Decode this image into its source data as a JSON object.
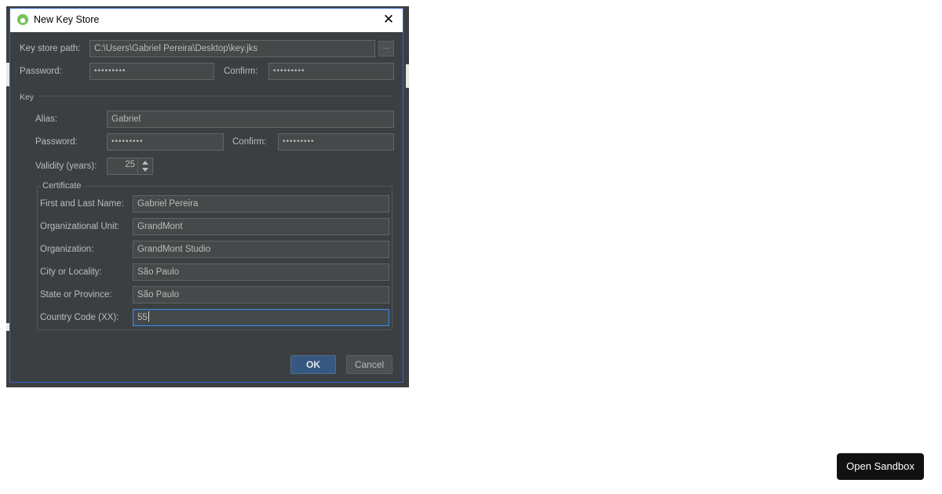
{
  "dialog": {
    "title": "New Key Store",
    "close_glyph": "✕",
    "keystore_path_label": "Key store path:",
    "keystore_path_value": "C:\\Users\\Gabriel Pereira\\Desktop\\key.jks",
    "browse_label": "...",
    "password_label": "Password:",
    "password_value": "•••••••••",
    "confirm_label": "Confirm:",
    "confirm_value": "•••••••••"
  },
  "key": {
    "section_label": "Key",
    "alias_label": "Alias:",
    "alias_value": "Gabriel",
    "password_label": "Password:",
    "password_value": "•••••••••",
    "confirm_label": "Confirm:",
    "confirm_value": "•••••••••",
    "validity_label": "Validity (years):",
    "validity_value": "25"
  },
  "certificate": {
    "group_label": "Certificate",
    "fields": [
      {
        "label": "First and Last Name:",
        "value": "Gabriel Pereira"
      },
      {
        "label": "Organizational Unit:",
        "value": "GrandMont"
      },
      {
        "label": "Organization:",
        "value": "GrandMont Studio"
      },
      {
        "label": "City or Locality:",
        "value": "São Paulo"
      },
      {
        "label": "State or Province:",
        "value": "São Paulo"
      },
      {
        "label": "Country Code (XX):",
        "value": "55"
      }
    ]
  },
  "buttons": {
    "ok": "OK",
    "cancel": "Cancel"
  },
  "sandbox": {
    "label": "Open Sandbox"
  },
  "icons": {
    "app": "android-studio-icon",
    "close": "close-icon",
    "spinner_up": "chevron-up-icon",
    "spinner_down": "chevron-down-icon"
  },
  "colors": {
    "dialog_bg": "#3c3f41",
    "field_bg": "#45494a",
    "accent_border": "#2f65ca",
    "ok_button": "#365880"
  }
}
